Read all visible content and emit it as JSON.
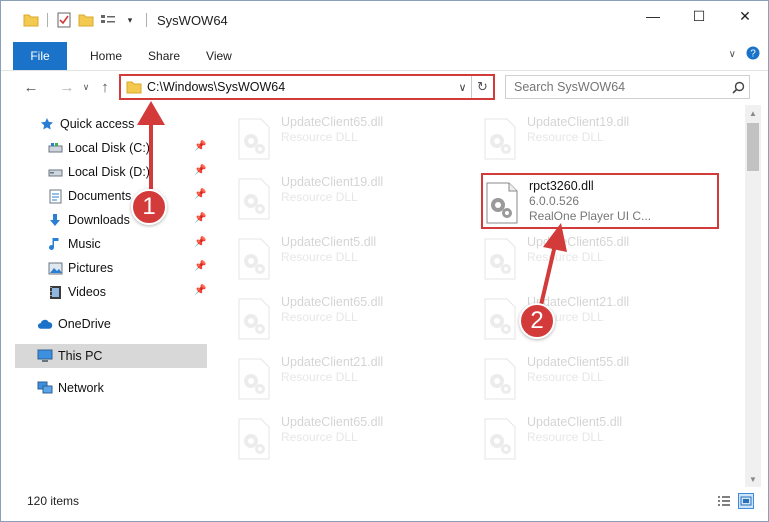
{
  "window": {
    "title": "SysWOW64",
    "controls": {
      "minimize": "—",
      "maximize": "☐",
      "close": "✕"
    }
  },
  "ribbon": {
    "file_label": "File",
    "tabs": [
      "Home",
      "Share",
      "View"
    ]
  },
  "address": {
    "path": "C:\\Windows\\SysWOW64",
    "dropdown": "∨",
    "refresh": "↻"
  },
  "search": {
    "placeholder": "Search SysWOW64"
  },
  "navpane": {
    "items": [
      {
        "label": "Quick access",
        "icon": "star-icon",
        "pinned": false
      },
      {
        "label": "Local Disk (C:)",
        "icon": "drive-icon",
        "pinned": true
      },
      {
        "label": "Local Disk (D:)",
        "icon": "drive-icon",
        "pinned": true
      },
      {
        "label": "Documents",
        "icon": "documents-icon",
        "pinned": true
      },
      {
        "label": "Downloads",
        "icon": "downloads-icon",
        "pinned": true
      },
      {
        "label": "Music",
        "icon": "music-icon",
        "pinned": true
      },
      {
        "label": "Pictures",
        "icon": "pictures-icon",
        "pinned": true
      },
      {
        "label": "Videos",
        "icon": "videos-icon",
        "pinned": true
      },
      {
        "label": "OneDrive",
        "icon": "cloud-icon",
        "pinned": false
      },
      {
        "label": "This PC",
        "icon": "computer-icon",
        "pinned": false,
        "selected": true
      },
      {
        "label": "Network",
        "icon": "network-icon",
        "pinned": false
      }
    ]
  },
  "files": {
    "faded": [
      {
        "name": "UpdateClient65.dll",
        "desc": "Resource DLL"
      },
      {
        "name": "UpdateClient19.dll",
        "desc": "Resource DLL"
      },
      {
        "name": "UpdateClient19.dll",
        "desc": "Resource DLL"
      },
      {
        "name": "UpdateClient5.dll",
        "desc": "Resource DLL"
      },
      {
        "name": "UpdateClient65.dll",
        "desc": "Resource DLL"
      },
      {
        "name": "UpdateClient65.dll",
        "desc": "Resource DLL"
      },
      {
        "name": "UpdateClient21.dll",
        "desc": "Resource DLL"
      },
      {
        "name": "UpdateClient21.dll",
        "desc": "Resource DLL"
      },
      {
        "name": "UpdateClient55.dll",
        "desc": "Resource DLL"
      },
      {
        "name": "UpdateClient65.dll",
        "desc": "Resource DLL"
      },
      {
        "name": "UpdateClient5.dll",
        "desc": "Resource DLL"
      }
    ],
    "highlighted": {
      "name": "rpct3260.dll",
      "version": "6.0.0.526",
      "desc": "RealOne Player UI C..."
    }
  },
  "status": {
    "item_count": "120 items"
  },
  "markers": {
    "one": "1",
    "two": "2"
  },
  "colors": {
    "accent": "#1a73c8",
    "highlight": "#d33a3a",
    "selected": "#d8d8d8"
  }
}
